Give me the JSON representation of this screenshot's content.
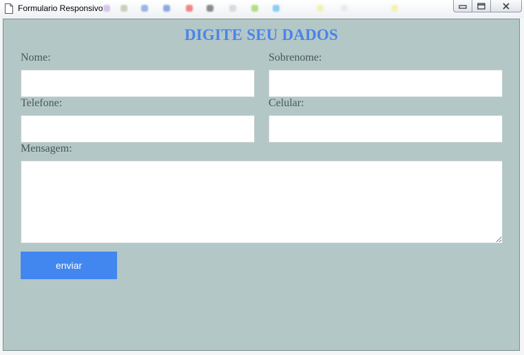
{
  "window": {
    "title": "Formulario Responsivo",
    "icons": {
      "app": "document-icon",
      "minimize": "minimize-icon",
      "restore": "restore-icon",
      "close": "close-icon"
    }
  },
  "form": {
    "heading": "DIGITE SEU DADOS",
    "fields": {
      "nome": {
        "label": "Nome:",
        "value": ""
      },
      "sobrenome": {
        "label": "Sobrenome:",
        "value": ""
      },
      "telefone": {
        "label": "Telefone:",
        "value": ""
      },
      "celular": {
        "label": "Celular:",
        "value": ""
      },
      "mensagem": {
        "label": "Mensagem:",
        "value": ""
      }
    },
    "submit_label": "enviar"
  },
  "colors": {
    "panel_background": "#b3c7c7",
    "heading": "#4a84e8",
    "button": "#4286f0",
    "label_text": "#4c5656"
  }
}
